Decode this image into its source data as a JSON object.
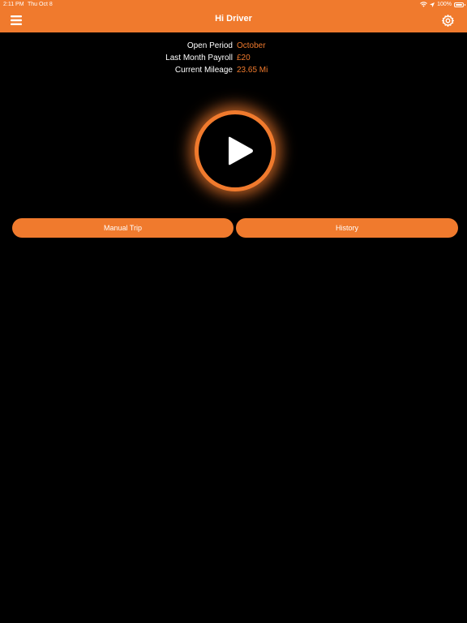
{
  "status_bar": {
    "time": "2:11 PM",
    "date": "Thu Oct 8",
    "battery": "100%",
    "battery_level": 1.0
  },
  "nav": {
    "title": "Hi Driver",
    "menu_icon": "hamburger-menu-icon",
    "settings_icon": "gear-icon"
  },
  "info": {
    "open_period_label": "Open Period",
    "open_period_value": "October",
    "payroll_label": "Last Month Payroll",
    "payroll_value": "£20",
    "mileage_label": "Current Mileage",
    "mileage_value": "23.65 Mi"
  },
  "play": {
    "icon": "play-icon"
  },
  "buttons": {
    "manual_trip": "Manual Trip",
    "history": "History"
  },
  "colors": {
    "accent": "#F07A2D",
    "background": "#000000",
    "text": "#FFFFFF"
  }
}
